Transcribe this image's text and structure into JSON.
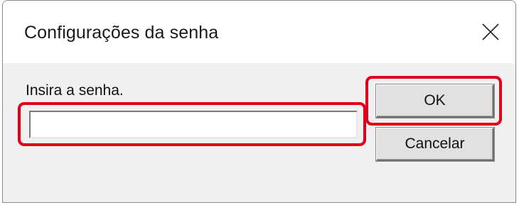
{
  "dialog": {
    "title": "Configurações da senha",
    "close_icon": "close-icon",
    "prompt": "Insira a senha.",
    "password_value": "",
    "ok_label": "OK",
    "cancel_label": "Cancelar"
  },
  "highlight_color": "#e0001a"
}
